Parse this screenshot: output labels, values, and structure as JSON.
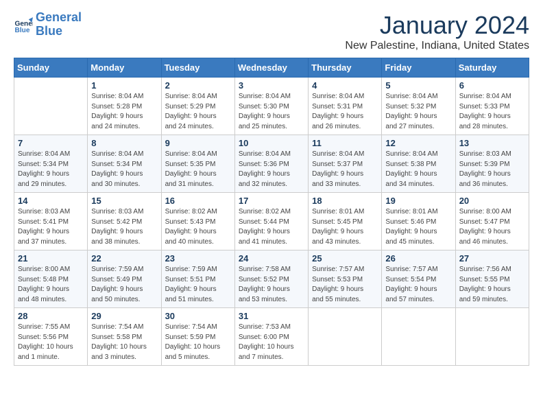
{
  "header": {
    "logo_line1": "General",
    "logo_line2": "Blue",
    "title": "January 2024",
    "subtitle": "New Palestine, Indiana, United States"
  },
  "days_of_week": [
    "Sunday",
    "Monday",
    "Tuesday",
    "Wednesday",
    "Thursday",
    "Friday",
    "Saturday"
  ],
  "weeks": [
    [
      {
        "day": "",
        "info": ""
      },
      {
        "day": "1",
        "info": "Sunrise: 8:04 AM\nSunset: 5:28 PM\nDaylight: 9 hours\nand 24 minutes."
      },
      {
        "day": "2",
        "info": "Sunrise: 8:04 AM\nSunset: 5:29 PM\nDaylight: 9 hours\nand 24 minutes."
      },
      {
        "day": "3",
        "info": "Sunrise: 8:04 AM\nSunset: 5:30 PM\nDaylight: 9 hours\nand 25 minutes."
      },
      {
        "day": "4",
        "info": "Sunrise: 8:04 AM\nSunset: 5:31 PM\nDaylight: 9 hours\nand 26 minutes."
      },
      {
        "day": "5",
        "info": "Sunrise: 8:04 AM\nSunset: 5:32 PM\nDaylight: 9 hours\nand 27 minutes."
      },
      {
        "day": "6",
        "info": "Sunrise: 8:04 AM\nSunset: 5:33 PM\nDaylight: 9 hours\nand 28 minutes."
      }
    ],
    [
      {
        "day": "7",
        "info": "Sunrise: 8:04 AM\nSunset: 5:34 PM\nDaylight: 9 hours\nand 29 minutes."
      },
      {
        "day": "8",
        "info": "Sunrise: 8:04 AM\nSunset: 5:34 PM\nDaylight: 9 hours\nand 30 minutes."
      },
      {
        "day": "9",
        "info": "Sunrise: 8:04 AM\nSunset: 5:35 PM\nDaylight: 9 hours\nand 31 minutes."
      },
      {
        "day": "10",
        "info": "Sunrise: 8:04 AM\nSunset: 5:36 PM\nDaylight: 9 hours\nand 32 minutes."
      },
      {
        "day": "11",
        "info": "Sunrise: 8:04 AM\nSunset: 5:37 PM\nDaylight: 9 hours\nand 33 minutes."
      },
      {
        "day": "12",
        "info": "Sunrise: 8:04 AM\nSunset: 5:38 PM\nDaylight: 9 hours\nand 34 minutes."
      },
      {
        "day": "13",
        "info": "Sunrise: 8:03 AM\nSunset: 5:39 PM\nDaylight: 9 hours\nand 36 minutes."
      }
    ],
    [
      {
        "day": "14",
        "info": "Sunrise: 8:03 AM\nSunset: 5:41 PM\nDaylight: 9 hours\nand 37 minutes."
      },
      {
        "day": "15",
        "info": "Sunrise: 8:03 AM\nSunset: 5:42 PM\nDaylight: 9 hours\nand 38 minutes."
      },
      {
        "day": "16",
        "info": "Sunrise: 8:02 AM\nSunset: 5:43 PM\nDaylight: 9 hours\nand 40 minutes."
      },
      {
        "day": "17",
        "info": "Sunrise: 8:02 AM\nSunset: 5:44 PM\nDaylight: 9 hours\nand 41 minutes."
      },
      {
        "day": "18",
        "info": "Sunrise: 8:01 AM\nSunset: 5:45 PM\nDaylight: 9 hours\nand 43 minutes."
      },
      {
        "day": "19",
        "info": "Sunrise: 8:01 AM\nSunset: 5:46 PM\nDaylight: 9 hours\nand 45 minutes."
      },
      {
        "day": "20",
        "info": "Sunrise: 8:00 AM\nSunset: 5:47 PM\nDaylight: 9 hours\nand 46 minutes."
      }
    ],
    [
      {
        "day": "21",
        "info": "Sunrise: 8:00 AM\nSunset: 5:48 PM\nDaylight: 9 hours\nand 48 minutes."
      },
      {
        "day": "22",
        "info": "Sunrise: 7:59 AM\nSunset: 5:49 PM\nDaylight: 9 hours\nand 50 minutes."
      },
      {
        "day": "23",
        "info": "Sunrise: 7:59 AM\nSunset: 5:51 PM\nDaylight: 9 hours\nand 51 minutes."
      },
      {
        "day": "24",
        "info": "Sunrise: 7:58 AM\nSunset: 5:52 PM\nDaylight: 9 hours\nand 53 minutes."
      },
      {
        "day": "25",
        "info": "Sunrise: 7:57 AM\nSunset: 5:53 PM\nDaylight: 9 hours\nand 55 minutes."
      },
      {
        "day": "26",
        "info": "Sunrise: 7:57 AM\nSunset: 5:54 PM\nDaylight: 9 hours\nand 57 minutes."
      },
      {
        "day": "27",
        "info": "Sunrise: 7:56 AM\nSunset: 5:55 PM\nDaylight: 9 hours\nand 59 minutes."
      }
    ],
    [
      {
        "day": "28",
        "info": "Sunrise: 7:55 AM\nSunset: 5:56 PM\nDaylight: 10 hours\nand 1 minute."
      },
      {
        "day": "29",
        "info": "Sunrise: 7:54 AM\nSunset: 5:58 PM\nDaylight: 10 hours\nand 3 minutes."
      },
      {
        "day": "30",
        "info": "Sunrise: 7:54 AM\nSunset: 5:59 PM\nDaylight: 10 hours\nand 5 minutes."
      },
      {
        "day": "31",
        "info": "Sunrise: 7:53 AM\nSunset: 6:00 PM\nDaylight: 10 hours\nand 7 minutes."
      },
      {
        "day": "",
        "info": ""
      },
      {
        "day": "",
        "info": ""
      },
      {
        "day": "",
        "info": ""
      }
    ]
  ]
}
